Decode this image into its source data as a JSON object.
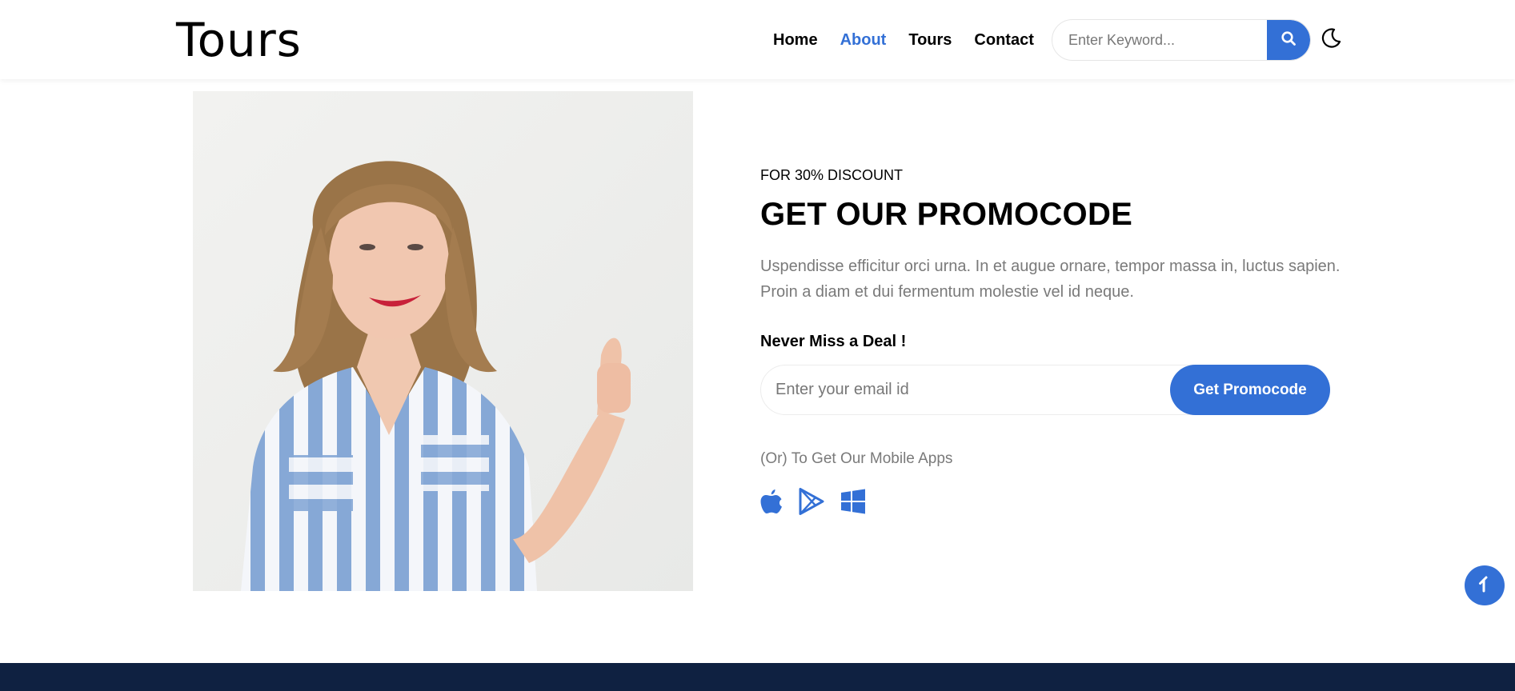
{
  "header": {
    "logo": "Tours",
    "nav": [
      {
        "label": "Home",
        "active": false
      },
      {
        "label": "About",
        "active": true
      },
      {
        "label": "Tours",
        "active": false
      },
      {
        "label": "Contact",
        "active": false
      }
    ],
    "search_placeholder": "Enter Keyword...",
    "search_icon": "search-icon",
    "theme_icon": "moon-icon"
  },
  "promo": {
    "eyebrow": "FOR 30% DISCOUNT",
    "title": "GET OUR PROMOCODE",
    "description": "Uspendisse efficitur orci urna. In et augue ornare, tempor massa in, luctus sapien. Proin a diam et dui fermentum molestie vel id neque.",
    "deal_heading": "Never Miss a Deal !",
    "email_placeholder": "Enter your email id",
    "button_label": "Get Promocode",
    "apps_text": "(Or) To Get Our Mobile Apps",
    "app_icons": [
      "apple-icon",
      "google-play-icon",
      "windows-icon"
    ]
  },
  "colors": {
    "accent": "#3370d6",
    "footer": "#0f2141",
    "muted_text": "#7a7a7a"
  }
}
